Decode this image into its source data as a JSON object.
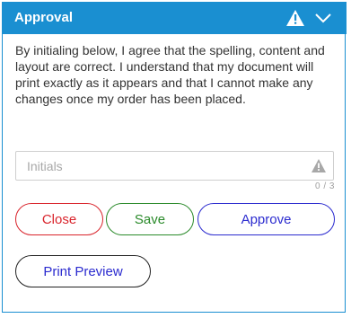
{
  "header": {
    "title": "Approval",
    "warning_icon": "warning-triangle-icon",
    "collapse_icon": "chevron-down-icon",
    "color": "#1a8fd1"
  },
  "notice": {
    "text": "By initialing below, I agree that the spelling, content and layout are correct. I understand that my document will print exactly as it appears and that I cannot make any changes once my order has been placed."
  },
  "initials": {
    "value": "",
    "placeholder": "Initials",
    "warning_icon": "warning-triangle-icon",
    "counter": "0 / 3"
  },
  "buttons": {
    "close_label": "Close",
    "save_label": "Save",
    "approve_label": "Approve",
    "preview_label": "Print Preview"
  },
  "colors": {
    "close": "#d9242c",
    "save": "#2a8a2a",
    "approve": "#2b2bcf",
    "preview_text": "#2b2bcf"
  }
}
